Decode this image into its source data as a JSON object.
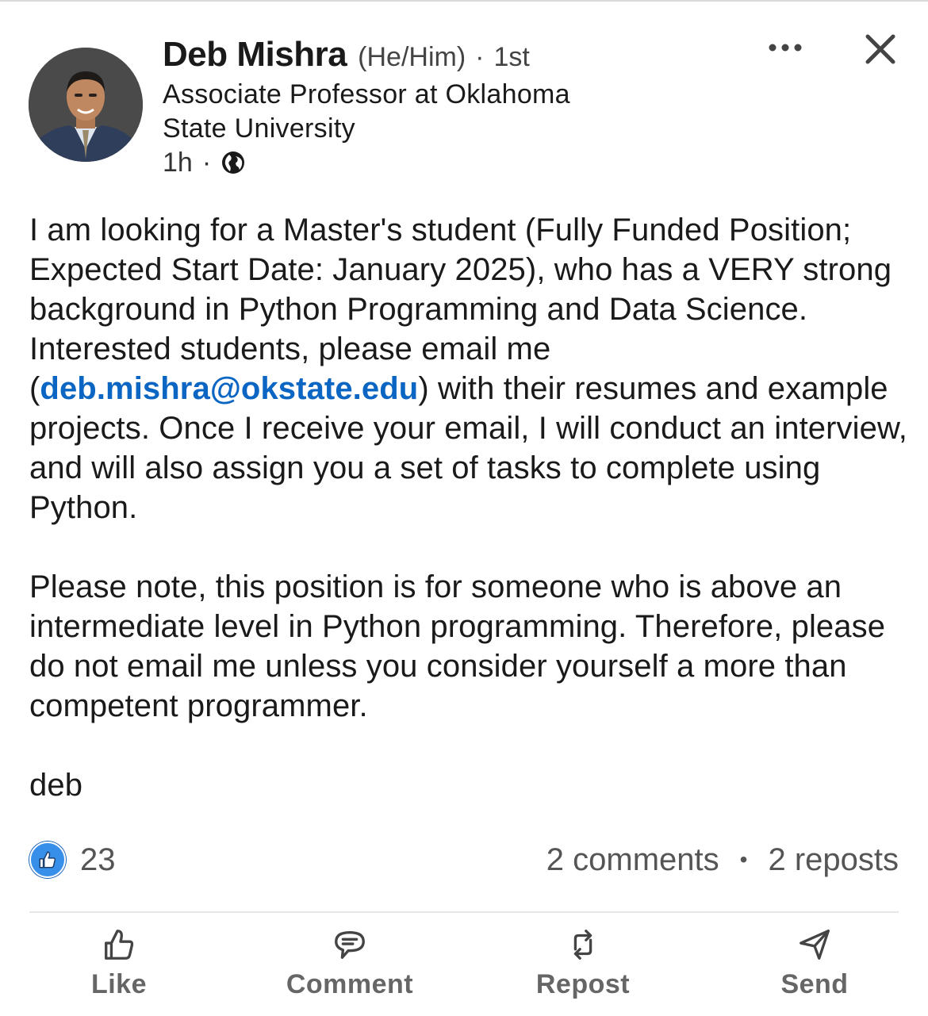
{
  "post": {
    "author": {
      "name": "Deb Mishra",
      "pronouns": "(He/Him)",
      "connection_separator": "·",
      "connection_degree": "1st",
      "headline": "Associate Professor at Oklahoma State University",
      "time_posted": "1h",
      "time_separator": "·",
      "visibility_icon": "globe-icon",
      "avatar": "profile-photo"
    },
    "controls": {
      "more_icon": "more-horizontal-icon",
      "close_icon": "close-icon"
    },
    "body": {
      "paragraph1_before_email": "I am looking for a Master's student (Fully Funded Position; Expected Start Date: January 2025), who has a VERY strong background in Python Programming and Data Science. Interested students, please email me (",
      "email": "deb.mishra@okstate.edu",
      "paragraph1_after_email": ") with their resumes and example projects. Once I receive your email, I will conduct an interview, and will also assign you a set of tasks to complete using Python.",
      "paragraph2": "Please note, this position is for someone who is above an intermediate level in Python programming. Therefore, please do not email me unless you consider yourself a more than competent programmer.",
      "signoff": "deb"
    },
    "stats": {
      "reaction_icon": "like-reaction-icon",
      "reaction_count": "23",
      "comments": "2 comments",
      "separator": "•",
      "reposts": "2 reposts"
    },
    "actions": [
      {
        "label": "Like",
        "icon": "like-icon"
      },
      {
        "label": "Comment",
        "icon": "comment-icon"
      },
      {
        "label": "Repost",
        "icon": "repost-icon"
      },
      {
        "label": "Send",
        "icon": "send-icon"
      }
    ],
    "colors": {
      "link": "#0a66c2",
      "like_badge": "#378fe9",
      "muted_text": "#666666"
    }
  }
}
